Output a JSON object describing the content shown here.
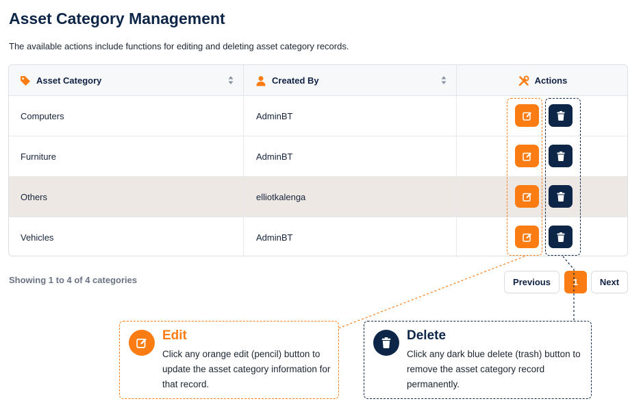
{
  "page": {
    "title": "Asset Category Management",
    "description": "The available actions include functions for editing and deleting asset category records."
  },
  "table": {
    "columns": [
      {
        "label": "Asset Category",
        "icon": "tag-icon"
      },
      {
        "label": "Created By",
        "icon": "user-icon"
      },
      {
        "label": "Actions",
        "icon": "tools-icon"
      }
    ],
    "rows": [
      {
        "category": "Computers",
        "created_by": "AdminBT"
      },
      {
        "category": "Furniture",
        "created_by": "AdminBT"
      },
      {
        "category": "Others",
        "created_by": "elliotkalenga"
      },
      {
        "category": "Vehicles",
        "created_by": "AdminBT"
      }
    ]
  },
  "footer": {
    "showing": "Showing 1 to 4 of 4 categories",
    "previous_label": "Previous",
    "current_page": "1",
    "next_label": "Next"
  },
  "callouts": {
    "edit": {
      "title": "Edit",
      "body": "Click any orange edit (pencil) button to update the asset category information for that record."
    },
    "delete": {
      "title": "Delete",
      "body": "Click any dark blue delete (trash) button to remove the asset category record permanently."
    }
  },
  "colors": {
    "accent_orange": "#fb7c12",
    "brand_navy": "#0d2547",
    "highlight_row": "#ede8e3"
  }
}
